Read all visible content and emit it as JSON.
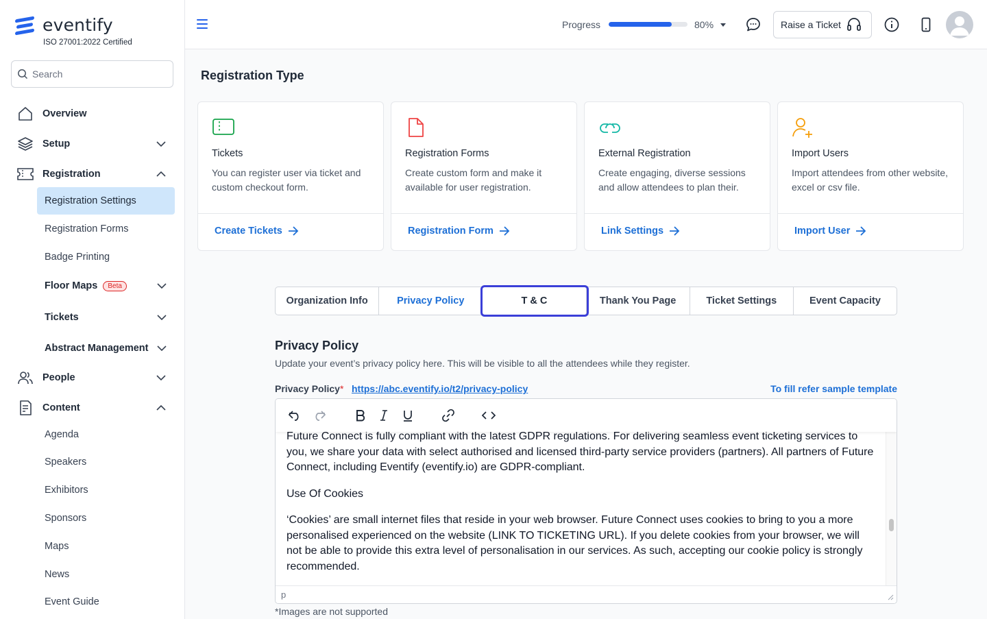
{
  "brand": {
    "name": "eventify",
    "certification": "ISO 27001:2022 Certified",
    "accent": "#2563eb"
  },
  "search": {
    "placeholder": "Search"
  },
  "sidebar": {
    "main": [
      {
        "label": "Overview",
        "icon": "home-icon"
      },
      {
        "label": "Setup",
        "icon": "layers-icon"
      },
      {
        "label": "Registration",
        "icon": "ticket-icon"
      },
      {
        "label": "People",
        "icon": "users-icon"
      },
      {
        "label": "Content",
        "icon": "document-icon"
      }
    ],
    "registration_items": [
      {
        "label": "Registration Settings"
      },
      {
        "label": "Registration Forms"
      },
      {
        "label": "Badge Printing"
      },
      {
        "label": "Floor Maps",
        "badge": "Beta"
      },
      {
        "label": "Tickets"
      },
      {
        "label": "Abstract Management"
      }
    ],
    "content_items": [
      "Agenda",
      "Speakers",
      "Exhibitors",
      "Sponsors",
      "Maps",
      "News",
      "Event Guide"
    ]
  },
  "header": {
    "progress_label": "Progress",
    "progress_value": 0.8,
    "progress_text": "80%",
    "raise_ticket": "Raise a Ticket"
  },
  "main": {
    "section_title": "Registration Type",
    "cards": [
      {
        "title": "Tickets",
        "desc": "You can register user via ticket and custom checkout form.",
        "link": "Create Tickets",
        "icon": "ticket-outline-icon",
        "color": "#16a34a"
      },
      {
        "title": "Registration Forms",
        "desc": "Create custom form and make it available for user registration.",
        "link": "Registration Form",
        "icon": "file-icon",
        "color": "#ef4444"
      },
      {
        "title": "External Registration",
        "desc": "Create engaging, diverse sessions and allow attendees to plan their.",
        "link": "Link Settings",
        "icon": "link-icon",
        "color": "#14b8a6"
      },
      {
        "title": "Import Users",
        "desc": "Import attendees from other website, excel or csv file.",
        "link": "Import User",
        "icon": "user-plus-icon",
        "color": "#f59e0b"
      }
    ],
    "tabs": [
      "Organization Info",
      "Privacy Policy",
      "T & C",
      "Thank You Page",
      "Ticket Settings",
      "Event Capacity"
    ],
    "privacy": {
      "title": "Privacy Policy",
      "description": "Update your event’s privacy policy here. This will be visible to all the attendees while they register.",
      "label": "Privacy Policy",
      "required_mark": "*",
      "url": "https://abc.eventify.io/t2/privacy-policy",
      "template_link": "To fill refer sample template",
      "paragraphs": [
        "Future Connect is fully compliant with the latest GDPR regulations. For delivering seamless event ticketing services to you, we share your data with select authorised and licensed third-party service providers (partners). All partners of Future Connect, including Eventify (eventify.io) are GDPR-compliant.",
        "Use Of Cookies",
        "‘Cookies’ are small internet files that reside in your web browser. Future Connect uses cookies to bring to you a more personalised experienced on the website (LINK TO TICKETING URL). If you delete cookies from your browser, we will not be able to provide this extra level of personalisation in our services. As such, accepting our cookie policy is strongly recommended."
      ],
      "status_path": "p",
      "note": "*Images are not supported"
    }
  }
}
